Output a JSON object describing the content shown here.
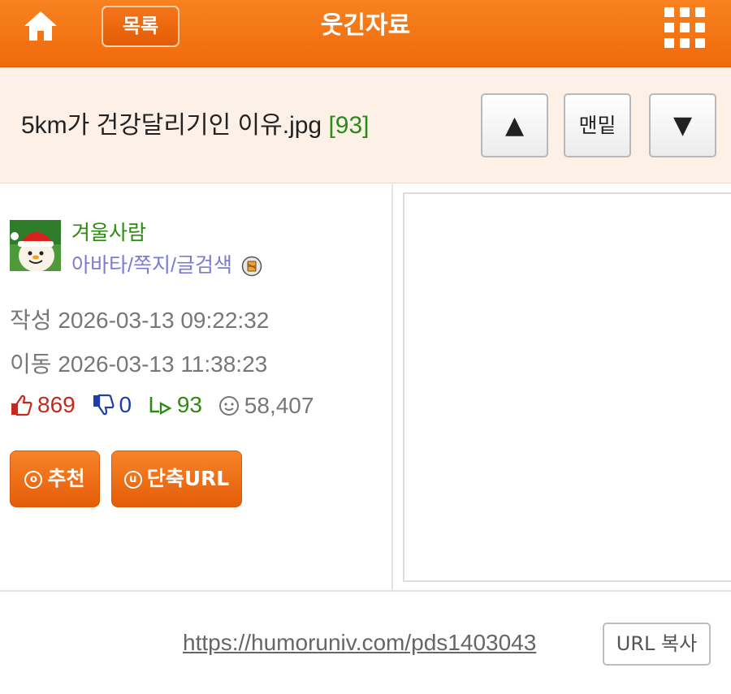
{
  "header": {
    "home_icon": "home-icon",
    "list_button": "목록",
    "title": "웃긴자료",
    "menu_icon": "grid-menu-icon"
  },
  "post": {
    "title": "5km가 건강달리기인 이유.jpg",
    "comment_count": "[93]",
    "nav": {
      "up_label": "▲",
      "bottom_label": "맨밑",
      "down_label": "▼"
    }
  },
  "author": {
    "name": "겨울사람",
    "links": [
      "아바타",
      "쪽지",
      "글검색"
    ],
    "separator": "/"
  },
  "meta": {
    "created_label": "작성",
    "created": "2026-03-13 09:22:32",
    "moved_label": "이동",
    "moved": "2026-03-13 11:38:23"
  },
  "stats": {
    "recommend": "869",
    "dislike": "0",
    "replies": "93",
    "views": "58,407"
  },
  "actions": {
    "recommend_label": "추천",
    "recommend_icon": "o",
    "short_url_label": "단축URL",
    "short_url_icon": "u"
  },
  "footer": {
    "url": "https://humoruniv.com/pds1403043",
    "copy_label": "URL 복사"
  },
  "colors": {
    "header_orange": "#f06a0c",
    "title_band_bg": "#fdf1e7",
    "author_green": "#2d8b12",
    "link_purple": "#7b7bd3",
    "like_red": "#c7281e",
    "dislike_blue": "#1d3fa6"
  }
}
